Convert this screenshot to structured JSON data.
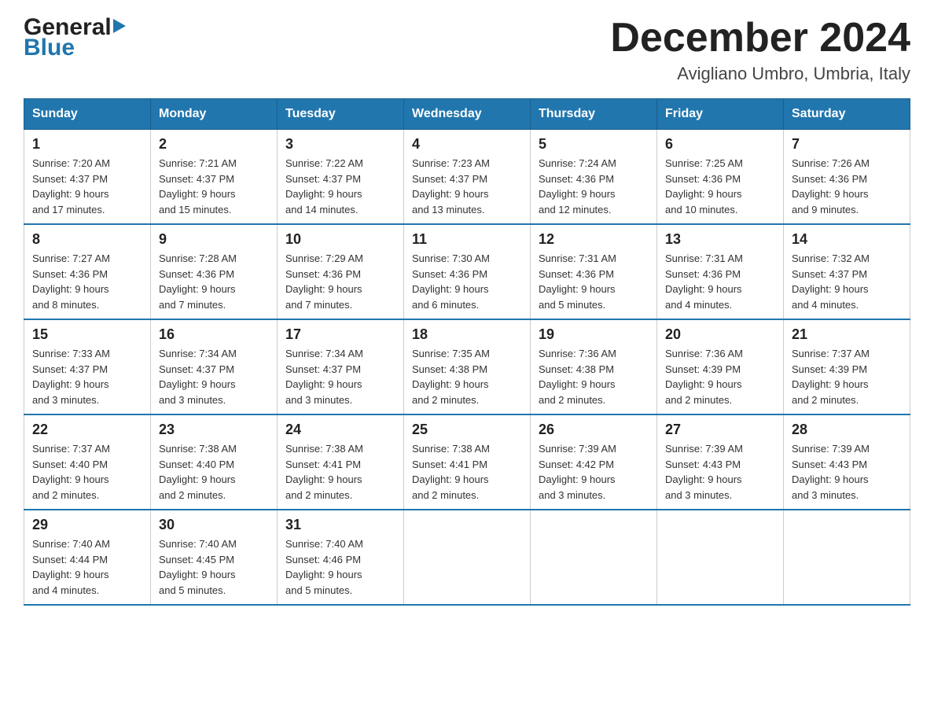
{
  "header": {
    "logo_general": "General",
    "logo_blue": "Blue",
    "month_title": "December 2024",
    "location": "Avigliano Umbro, Umbria, Italy"
  },
  "days_of_week": [
    "Sunday",
    "Monday",
    "Tuesday",
    "Wednesday",
    "Thursday",
    "Friday",
    "Saturday"
  ],
  "weeks": [
    [
      {
        "day": "1",
        "sunrise": "7:20 AM",
        "sunset": "4:37 PM",
        "daylight": "9 hours and 17 minutes."
      },
      {
        "day": "2",
        "sunrise": "7:21 AM",
        "sunset": "4:37 PM",
        "daylight": "9 hours and 15 minutes."
      },
      {
        "day": "3",
        "sunrise": "7:22 AM",
        "sunset": "4:37 PM",
        "daylight": "9 hours and 14 minutes."
      },
      {
        "day": "4",
        "sunrise": "7:23 AM",
        "sunset": "4:37 PM",
        "daylight": "9 hours and 13 minutes."
      },
      {
        "day": "5",
        "sunrise": "7:24 AM",
        "sunset": "4:36 PM",
        "daylight": "9 hours and 12 minutes."
      },
      {
        "day": "6",
        "sunrise": "7:25 AM",
        "sunset": "4:36 PM",
        "daylight": "9 hours and 10 minutes."
      },
      {
        "day": "7",
        "sunrise": "7:26 AM",
        "sunset": "4:36 PM",
        "daylight": "9 hours and 9 minutes."
      }
    ],
    [
      {
        "day": "8",
        "sunrise": "7:27 AM",
        "sunset": "4:36 PM",
        "daylight": "9 hours and 8 minutes."
      },
      {
        "day": "9",
        "sunrise": "7:28 AM",
        "sunset": "4:36 PM",
        "daylight": "9 hours and 7 minutes."
      },
      {
        "day": "10",
        "sunrise": "7:29 AM",
        "sunset": "4:36 PM",
        "daylight": "9 hours and 7 minutes."
      },
      {
        "day": "11",
        "sunrise": "7:30 AM",
        "sunset": "4:36 PM",
        "daylight": "9 hours and 6 minutes."
      },
      {
        "day": "12",
        "sunrise": "7:31 AM",
        "sunset": "4:36 PM",
        "daylight": "9 hours and 5 minutes."
      },
      {
        "day": "13",
        "sunrise": "7:31 AM",
        "sunset": "4:36 PM",
        "daylight": "9 hours and 4 minutes."
      },
      {
        "day": "14",
        "sunrise": "7:32 AM",
        "sunset": "4:37 PM",
        "daylight": "9 hours and 4 minutes."
      }
    ],
    [
      {
        "day": "15",
        "sunrise": "7:33 AM",
        "sunset": "4:37 PM",
        "daylight": "9 hours and 3 minutes."
      },
      {
        "day": "16",
        "sunrise": "7:34 AM",
        "sunset": "4:37 PM",
        "daylight": "9 hours and 3 minutes."
      },
      {
        "day": "17",
        "sunrise": "7:34 AM",
        "sunset": "4:37 PM",
        "daylight": "9 hours and 3 minutes."
      },
      {
        "day": "18",
        "sunrise": "7:35 AM",
        "sunset": "4:38 PM",
        "daylight": "9 hours and 2 minutes."
      },
      {
        "day": "19",
        "sunrise": "7:36 AM",
        "sunset": "4:38 PM",
        "daylight": "9 hours and 2 minutes."
      },
      {
        "day": "20",
        "sunrise": "7:36 AM",
        "sunset": "4:39 PM",
        "daylight": "9 hours and 2 minutes."
      },
      {
        "day": "21",
        "sunrise": "7:37 AM",
        "sunset": "4:39 PM",
        "daylight": "9 hours and 2 minutes."
      }
    ],
    [
      {
        "day": "22",
        "sunrise": "7:37 AM",
        "sunset": "4:40 PM",
        "daylight": "9 hours and 2 minutes."
      },
      {
        "day": "23",
        "sunrise": "7:38 AM",
        "sunset": "4:40 PM",
        "daylight": "9 hours and 2 minutes."
      },
      {
        "day": "24",
        "sunrise": "7:38 AM",
        "sunset": "4:41 PM",
        "daylight": "9 hours and 2 minutes."
      },
      {
        "day": "25",
        "sunrise": "7:38 AM",
        "sunset": "4:41 PM",
        "daylight": "9 hours and 2 minutes."
      },
      {
        "day": "26",
        "sunrise": "7:39 AM",
        "sunset": "4:42 PM",
        "daylight": "9 hours and 3 minutes."
      },
      {
        "day": "27",
        "sunrise": "7:39 AM",
        "sunset": "4:43 PM",
        "daylight": "9 hours and 3 minutes."
      },
      {
        "day": "28",
        "sunrise": "7:39 AM",
        "sunset": "4:43 PM",
        "daylight": "9 hours and 3 minutes."
      }
    ],
    [
      {
        "day": "29",
        "sunrise": "7:40 AM",
        "sunset": "4:44 PM",
        "daylight": "9 hours and 4 minutes."
      },
      {
        "day": "30",
        "sunrise": "7:40 AM",
        "sunset": "4:45 PM",
        "daylight": "9 hours and 5 minutes."
      },
      {
        "day": "31",
        "sunrise": "7:40 AM",
        "sunset": "4:46 PM",
        "daylight": "9 hours and 5 minutes."
      },
      null,
      null,
      null,
      null
    ]
  ],
  "labels": {
    "sunrise": "Sunrise:",
    "sunset": "Sunset:",
    "daylight": "Daylight:"
  }
}
